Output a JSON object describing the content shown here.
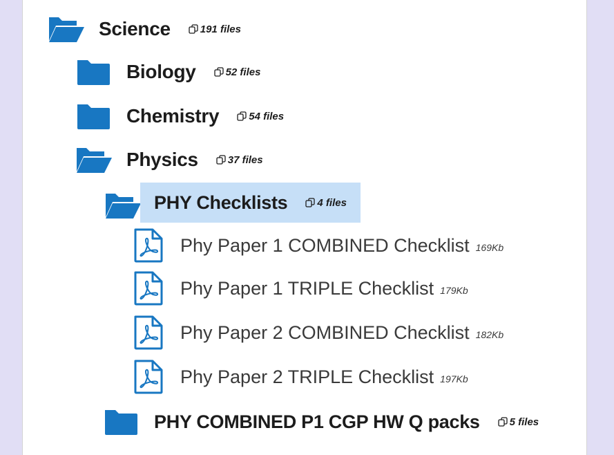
{
  "tree": {
    "science": {
      "label": "Science",
      "count": "191 files",
      "icon": "folder-open-icon"
    },
    "biology": {
      "label": "Biology",
      "count": "52 files",
      "icon": "folder-icon"
    },
    "chemistry": {
      "label": "Chemistry",
      "count": "54 files",
      "icon": "folder-icon"
    },
    "physics": {
      "label": "Physics",
      "count": "37 files",
      "icon": "folder-open-icon"
    },
    "phy_checklists": {
      "label": "PHY Checklists",
      "count": "4 files",
      "icon": "folder-open-icon"
    },
    "files": [
      {
        "name": "Phy Paper 1 COMBINED Checklist",
        "size": "169Kb",
        "icon": "pdf-icon"
      },
      {
        "name": "Phy Paper 1 TRIPLE Checklist",
        "size": "179Kb",
        "icon": "pdf-icon"
      },
      {
        "name": "Phy Paper 2 COMBINED Checklist",
        "size": "182Kb",
        "icon": "pdf-icon"
      },
      {
        "name": "Phy Paper 2 TRIPLE Checklist",
        "size": "197Kb",
        "icon": "pdf-icon"
      }
    ],
    "phy_combined": {
      "label": "PHY COMBINED P1 CGP HW Q packs",
      "count": "5 files",
      "icon": "folder-icon"
    }
  },
  "colors": {
    "folder": "#1877c2",
    "selected_bg": "#c6dff7",
    "page_bg": "#e1def5"
  }
}
